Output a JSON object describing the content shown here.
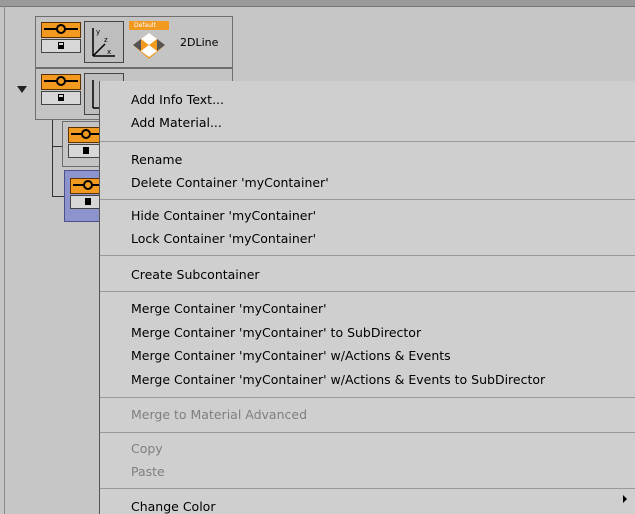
{
  "tree": {
    "node1_name": "2DLine",
    "material_badge": "Default"
  },
  "menu": {
    "items": [
      {
        "label": "Add Info Text...",
        "enabled": true
      },
      {
        "label": "Add Material...",
        "enabled": true
      },
      {
        "label": "Rename",
        "enabled": true
      },
      {
        "label": "Delete Container 'myContainer'",
        "enabled": true
      },
      {
        "label": "Hide Container 'myContainer'",
        "enabled": true
      },
      {
        "label": "Lock Container 'myContainer'",
        "enabled": true
      },
      {
        "label": "Create Subcontainer",
        "enabled": true
      },
      {
        "label": "Merge Container 'myContainer'",
        "enabled": true
      },
      {
        "label": "Merge Container 'myContainer' to SubDirector",
        "enabled": true
      },
      {
        "label": "Merge Container 'myContainer' w/Actions & Events",
        "enabled": true
      },
      {
        "label": "Merge Container 'myContainer' w/Actions & Events to SubDirector",
        "enabled": true
      },
      {
        "label": "Merge to Material Advanced",
        "enabled": false
      },
      {
        "label": "Copy",
        "enabled": false
      },
      {
        "label": "Paste",
        "enabled": false
      },
      {
        "label": "Change Color",
        "enabled": true,
        "submenu": true
      }
    ]
  },
  "colors": {
    "accent_orange": "#f2991f",
    "selected_node": "#8d93cc",
    "menu_background": "#cfcfcf"
  }
}
